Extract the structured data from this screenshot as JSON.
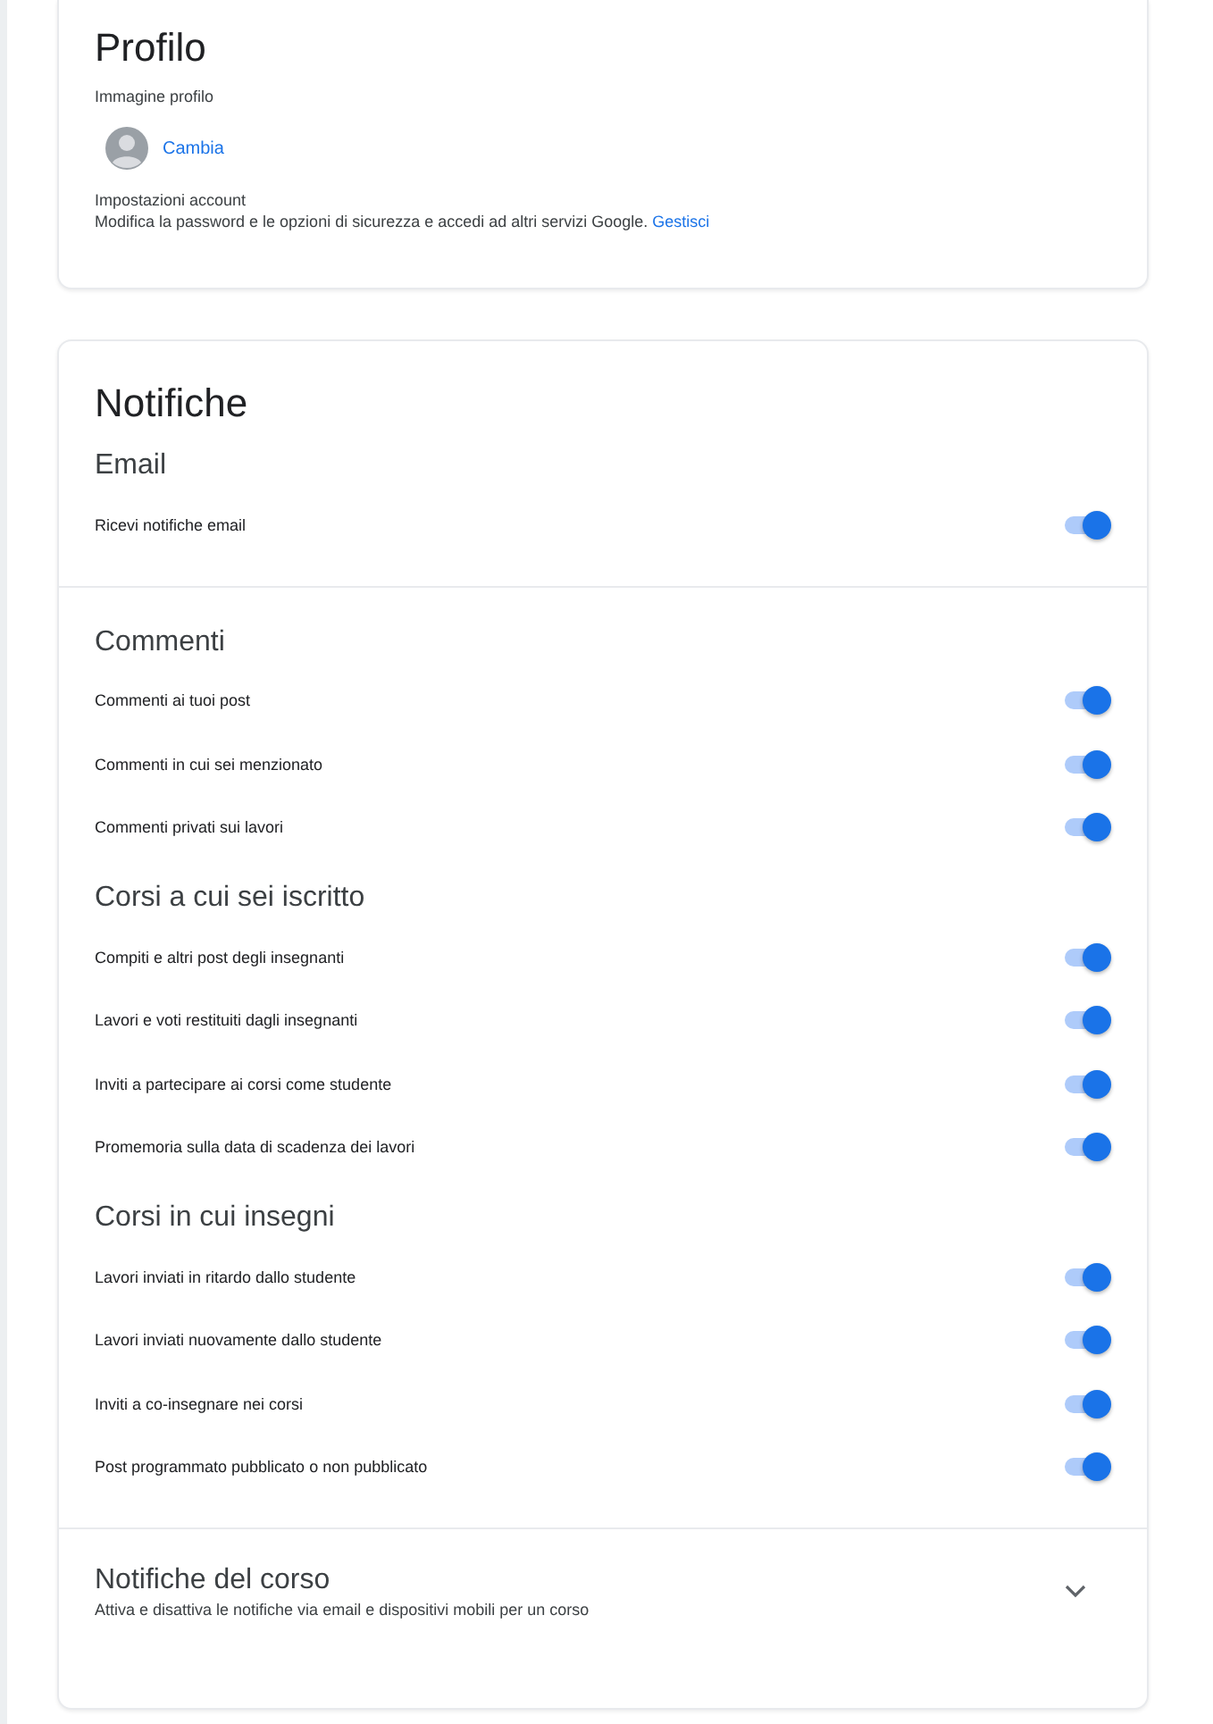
{
  "profile": {
    "title": "Profilo",
    "picture_label": "Immagine profilo",
    "change_link": "Cambia",
    "account_label": "Impostazioni account",
    "account_text": "Modifica la password e le opzioni di sicurezza e accedi ad altri servizi Google.",
    "account_link": "Gestisci"
  },
  "notifications": {
    "title": "Notifiche",
    "sections": [
      {
        "groups": [
          {
            "title": "Email",
            "items": [
              {
                "label": "Ricevi notifiche email",
                "on": true
              }
            ]
          }
        ]
      },
      {
        "groups": [
          {
            "title": "Commenti",
            "items": [
              {
                "label": "Commenti ai tuoi post",
                "on": true
              },
              {
                "label": "Commenti in cui sei menzionato",
                "on": true
              },
              {
                "label": "Commenti privati sui lavori",
                "on": true
              }
            ]
          },
          {
            "title": "Corsi a cui sei iscritto",
            "items": [
              {
                "label": "Compiti e altri post degli insegnanti",
                "on": true
              },
              {
                "label": "Lavori e voti restituiti dagli insegnanti",
                "on": true
              },
              {
                "label": "Inviti a partecipare ai corsi come studente",
                "on": true
              },
              {
                "label": "Promemoria sulla data di scadenza dei lavori",
                "on": true
              }
            ]
          },
          {
            "title": "Corsi in cui insegni",
            "items": [
              {
                "label": "Lavori inviati in ritardo dallo studente",
                "on": true
              },
              {
                "label": "Lavori inviati nuovamente dallo studente",
                "on": true
              },
              {
                "label": "Inviti a co-insegnare nei corsi",
                "on": true
              },
              {
                "label": "Post programmato pubblicato o non pubblicato",
                "on": true
              }
            ]
          }
        ]
      }
    ],
    "course": {
      "title": "Notifiche del corso",
      "subtitle": "Attiva e disattiva le notifiche via email e dispositivi mobili per un corso",
      "expanded": false
    }
  }
}
